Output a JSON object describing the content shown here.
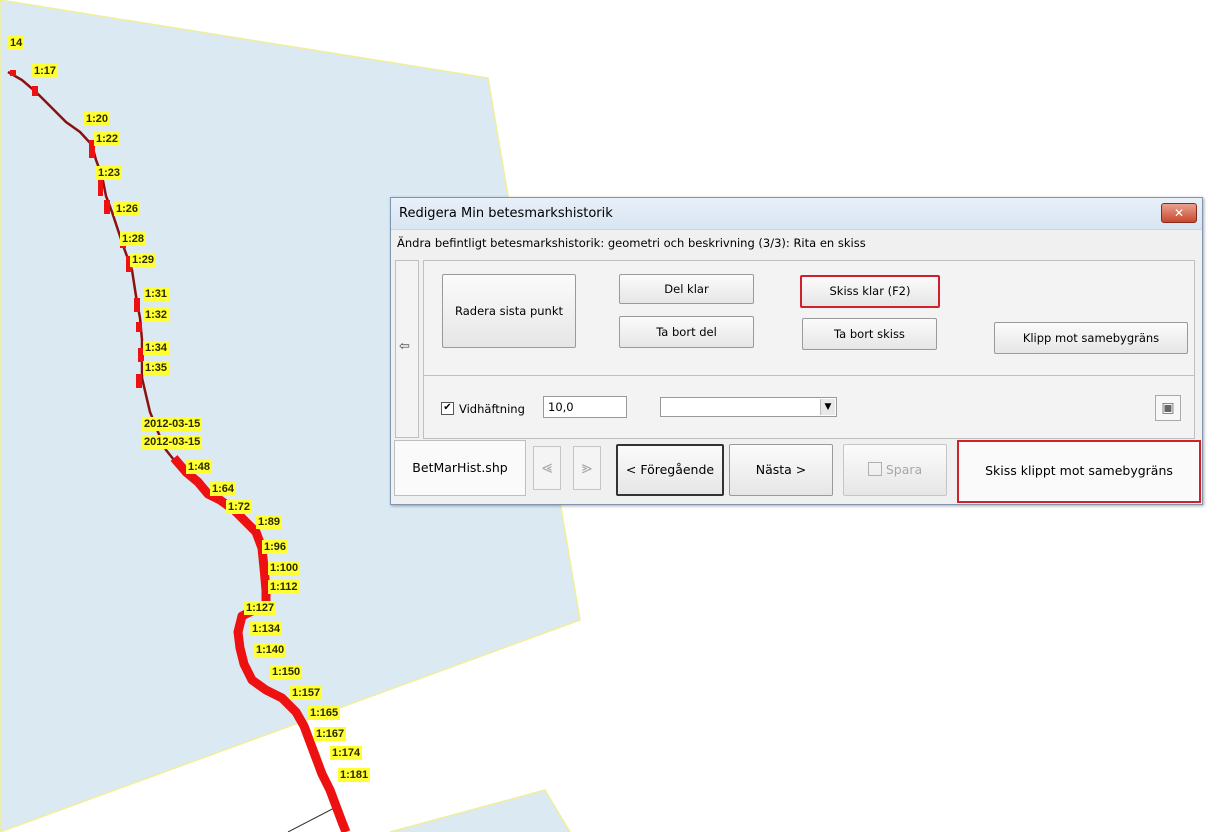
{
  "map": {
    "labels": [
      "14",
      "1:17",
      "1:20",
      "1:22",
      "1:23",
      "1:26",
      "1:28",
      "1:29",
      "1:31",
      "1:32",
      "1:34",
      "1:35",
      "2012-03-15",
      "2012-03-15",
      "1:48",
      "1:64",
      "1:72",
      "1:89",
      "1:96",
      "1:100",
      "1:112",
      "1:127",
      "1:134",
      "1:140",
      "1:150",
      "1:157",
      "1:165",
      "1:167",
      "1:174",
      "1:181"
    ]
  },
  "dialog": {
    "title": "Redigera Min betesmarkshistorik",
    "close": "✕",
    "subtitle": "Ändra befintligt betesmarkshistorik: geometri och beskrivning (3/3): Rita en skiss",
    "left_arrow": "⇦",
    "buttons": {
      "radera": "Radera sista punkt",
      "del_klar": "Del klar",
      "ta_bort_del": "Ta bort del",
      "skiss_klar": "Skiss klar (F2)",
      "ta_bort_skiss": "Ta bort skiss",
      "klipp": "Klipp mot samebygräns"
    },
    "vidhaftning": {
      "checked_mark": "✔",
      "label": "Vidhäftning",
      "value": "10,0"
    },
    "combo": {
      "selected": "",
      "arrow": "▼"
    },
    "tool_icon": "▣",
    "bottom": {
      "file": "BetMarHist.shp",
      "prev_arrow": "⪡",
      "next_arrow": "⪢",
      "foregaende": "< Föregående",
      "nasta": "Nästa >",
      "spara": "Spara",
      "status": "Skiss klippt mot samebygräns"
    }
  },
  "colors": {
    "map_fill": "#dbeaf2",
    "map_border": "#f0ee9a",
    "track_red": "#ee1111",
    "track_dark": "#8b1010",
    "label_bg": "#ffff33",
    "highlight_red": "#d0202a"
  }
}
